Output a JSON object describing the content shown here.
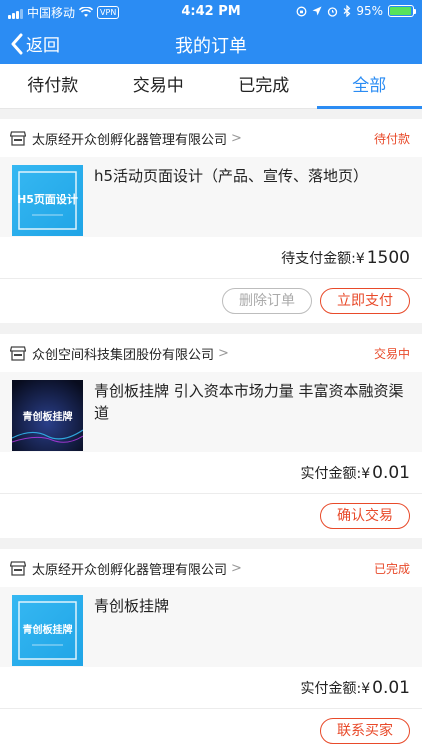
{
  "status_bar": {
    "carrier": "中国移动",
    "vpn": "VPN",
    "time": "4:42 PM",
    "battery": "95%",
    "battery_level": 0.95
  },
  "navbar": {
    "back_label": "返回",
    "title": "我的订单"
  },
  "tabs": [
    {
      "label": "待付款",
      "active": false
    },
    {
      "label": "交易中",
      "active": false
    },
    {
      "label": "已完成",
      "active": false
    },
    {
      "label": "全部",
      "active": true
    }
  ],
  "orders": [
    {
      "shop": "太原经开众创孵化器管理有限公司",
      "status": "待付款",
      "thumb_text": "H5页面设计",
      "title": "h5活动页面设计（产品、宣传、落地页）",
      "amount_label": "待支付金额:¥",
      "amount_value": "1500",
      "buttons": [
        "删除订单",
        "立即支付"
      ]
    },
    {
      "shop": "众创空间科技集团股份有限公司",
      "status": "交易中",
      "thumb_text": "青创板挂牌",
      "title": "青创板挂牌 引入资本市场力量 丰富资本融资渠道",
      "amount_label": "实付金额:¥",
      "amount_value": "0.01",
      "buttons": [
        "确认交易"
      ]
    },
    {
      "shop": "太原经开众创孵化器管理有限公司",
      "status": "已完成",
      "thumb_text": "青创板挂牌",
      "title": "青创板挂牌",
      "amount_label": "实付金额:¥",
      "amount_value": "0.01",
      "buttons": [
        "联系买家"
      ]
    }
  ],
  "colors": {
    "primary": "#2b8cf3",
    "accent": "#e84a2a"
  }
}
